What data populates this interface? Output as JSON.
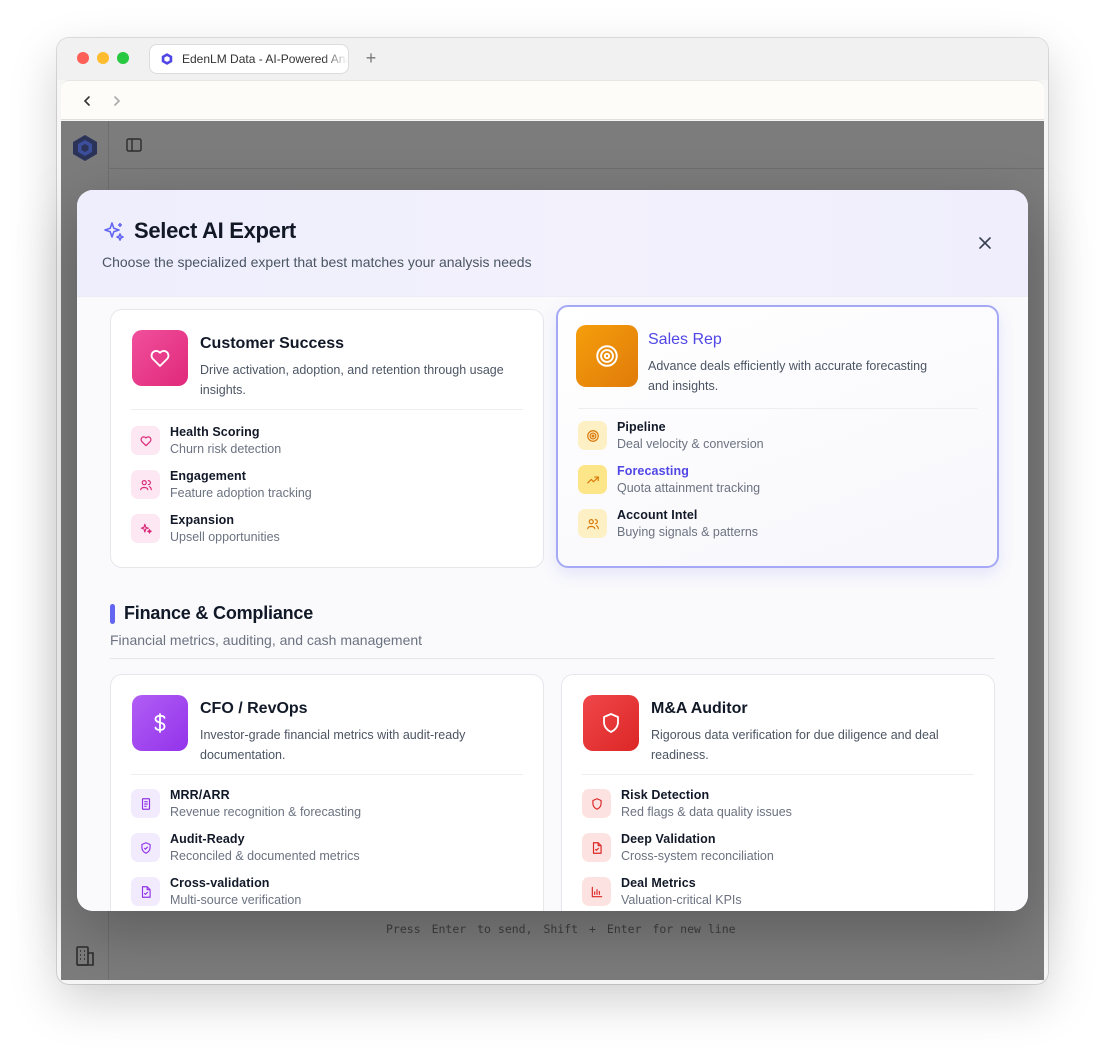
{
  "browser": {
    "tab_title": "EdenLM Data - AI-Powered Analytics",
    "new_tab_label": "+"
  },
  "app": {
    "hint": {
      "press": "Press",
      "key_enter": "Enter",
      "to_send": "to send,",
      "key_shift": "Shift",
      "plus": "+",
      "key_enter2": "Enter",
      "new_line": "for new line"
    }
  },
  "modal": {
    "title": "Select AI Expert",
    "subtitle": "Choose the specialized expert that best matches your analysis needs",
    "experts_top": [
      {
        "title": "Customer Success",
        "description": "Drive activation, adoption, and retention through usage insights.",
        "icon": "heart-icon",
        "color": "#ec4899",
        "features": [
          {
            "name": "Health Scoring",
            "desc": "Churn risk detection",
            "icon": "heart-icon"
          },
          {
            "name": "Engagement",
            "desc": "Feature adoption tracking",
            "icon": "users-icon"
          },
          {
            "name": "Expansion",
            "desc": "Upsell opportunities",
            "icon": "sparkle-icon"
          }
        ]
      },
      {
        "title": "Sales Rep",
        "description": "Advance deals efficiently with accurate forecasting and insights.",
        "icon": "target-icon",
        "color": "#f59e0b",
        "selected": true,
        "features": [
          {
            "name": "Pipeline",
            "desc": "Deal velocity & conversion",
            "icon": "target-icon"
          },
          {
            "name": "Forecasting",
            "desc": "Quota attainment tracking",
            "icon": "trend-up-icon",
            "active": true
          },
          {
            "name": "Account Intel",
            "desc": "Buying signals & patterns",
            "icon": "users-icon"
          }
        ]
      }
    ],
    "section": {
      "title": "Finance & Compliance",
      "description": "Financial metrics, auditing, and cash management"
    },
    "experts_bottom": [
      {
        "title": "CFO / RevOps",
        "description": "Investor-grade financial metrics with audit-ready documentation.",
        "icon": "dollar-icon",
        "color": "#a855f7",
        "features": [
          {
            "name": "MRR/ARR",
            "desc": "Revenue recognition & forecasting",
            "icon": "receipt-icon"
          },
          {
            "name": "Audit-Ready",
            "desc": "Reconciled & documented metrics",
            "icon": "shield-check-icon"
          },
          {
            "name": "Cross-validation",
            "desc": "Multi-source verification",
            "icon": "file-icon"
          }
        ]
      },
      {
        "title": "M&A Auditor",
        "description": "Rigorous data verification for due diligence and deal readiness.",
        "icon": "shield-icon",
        "color": "#ef4444",
        "features": [
          {
            "name": "Risk Detection",
            "desc": "Red flags & data quality issues",
            "icon": "shield-icon"
          },
          {
            "name": "Deep Validation",
            "desc": "Cross-system reconciliation",
            "icon": "file-icon"
          },
          {
            "name": "Deal Metrics",
            "desc": "Valuation-critical KPIs",
            "icon": "bar-chart-icon"
          }
        ]
      }
    ]
  }
}
